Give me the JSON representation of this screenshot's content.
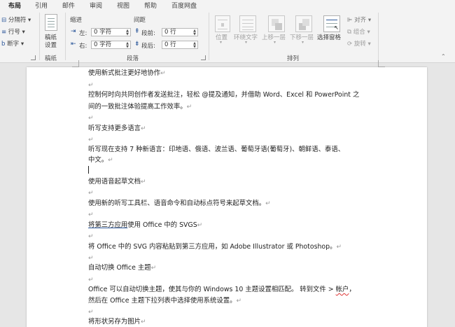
{
  "tabs": [
    "布局",
    "引用",
    "邮件",
    "审阅",
    "视图",
    "帮助",
    "百度网盘"
  ],
  "ribbon": {
    "page_setup": {
      "breaks_label": "分隔符",
      "line_numbers_label": "行号",
      "hyphenation_label": "断字"
    },
    "manuscript": {
      "button_label_line1": "稿纸",
      "button_label_line2": "设置",
      "group_label": "稿纸"
    },
    "paragraph": {
      "indent_header": "缩进",
      "spacing_header": "间距",
      "left_label": "左:",
      "right_label": "右:",
      "before_label": "段前:",
      "after_label": "段后:",
      "left_value": "0 字符",
      "right_value": "0 字符",
      "before_value": "0 行",
      "after_value": "0 行",
      "group_label": "段落"
    },
    "arrange": {
      "position_label": "位置",
      "wrap_text_label": "环绕文字",
      "bring_forward_label": "上移一层",
      "send_backward_label": "下移一层",
      "selection_pane_label": "选择窗格",
      "align_label": "对齐",
      "group_obj_label": "组合",
      "rotate_label": "旋转",
      "group_label": "排列"
    }
  },
  "document": {
    "lines": [
      "使用新式批注更好地协作",
      "控制何时向共同创作者发送批注，轻松 @提及通知，并借助 Word、Excel 和 PowerPoint 之",
      "间的一致批注体验提高工作效率。",
      "听写支持更多语言",
      "听写现在支持 7 种新语言：印地语、俄语、波兰语、葡萄牙语(葡萄牙)、朝鲜语、泰语、",
      "中文。",
      "使用语音起草文档",
      "使用新的听写工具栏、语音命令和自动标点符号来起草文档。",
      "将第三方应用",
      "使用 Office 中的 SVGS",
      "将 Office 中的 SVG 内容粘贴到第三方应用，如 Adobe Illustrator 或 Photoshop。",
      "自动切换 Office 主题",
      "Office 可以自动切换主题，使其与你的 Windows 10 主题设置相匹配。 转到文件 > ",
      "帐户",
      "，",
      "然后在 Office 主题下拉列表中选择使用系统设置。",
      "将形状另存为图片"
    ],
    "para_mark": "↵"
  }
}
